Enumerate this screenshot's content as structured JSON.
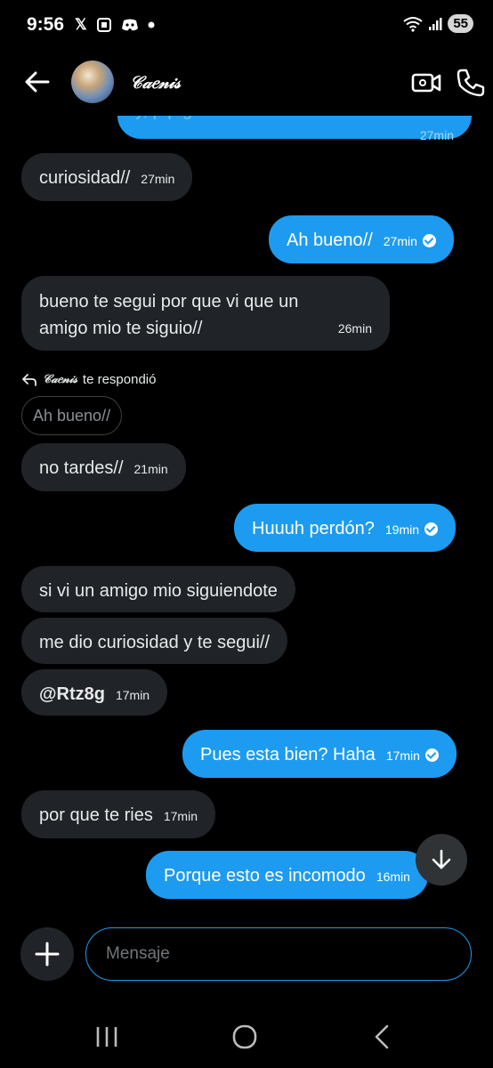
{
  "status_bar": {
    "time": "9:56",
    "icons": [
      "x-logo",
      "screenshot-icon",
      "discord-icon",
      "dot"
    ],
    "battery": "55"
  },
  "header": {
    "contact_name": "𝒞𝒶𝑒𝓃𝒾𝓈"
  },
  "messages": [
    {
      "dir": "out",
      "text": "y, p  p  g",
      "time": "27min",
      "partial": true
    },
    {
      "dir": "in",
      "text": "curiosidad//",
      "time": "27min"
    },
    {
      "dir": "out",
      "text": "Ah bueno//",
      "time": "27min"
    },
    {
      "dir": "in",
      "text_line1": "bueno te segui por que vi que un",
      "text_line2": "amigo mio te siguio//",
      "time": "26min"
    },
    {
      "dir": "in",
      "text": "no tardes//",
      "time": "21min"
    },
    {
      "dir": "out",
      "text": "Huuuh perdón?",
      "time": "19min"
    },
    {
      "dir": "in",
      "text": "si vi un amigo mio siguiendote"
    },
    {
      "dir": "in",
      "text": "me dio curiosidad y te segui//"
    },
    {
      "dir": "in",
      "text": "@Rtz8g",
      "time": "17min"
    },
    {
      "dir": "out",
      "text": "Pues esta bien? Haha",
      "time": "17min"
    },
    {
      "dir": "in",
      "text": "por que te ries",
      "time": "17min"
    },
    {
      "dir": "out",
      "text": "Porque esto es incomodo",
      "time": "16min"
    }
  ],
  "reply_context": {
    "name": "𝒞𝒶𝑒𝓃𝒾𝓈",
    "suffix": "te respondió",
    "quoted": "Ah bueno//"
  },
  "composer": {
    "placeholder": "Mensaje"
  },
  "colors": {
    "outgoing": "#1d9bf0",
    "incoming": "#202327",
    "background": "#000000"
  }
}
